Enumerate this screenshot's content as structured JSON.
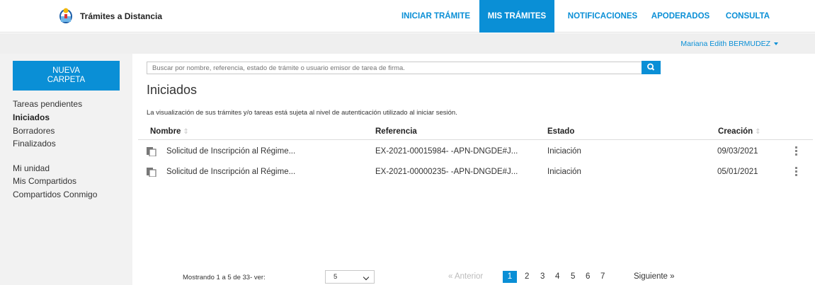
{
  "header": {
    "brand": "Trámites a Distancia",
    "nav": [
      {
        "label": "INICIAR TRÁMITE",
        "active": false
      },
      {
        "label": "MIS TRÁMITES",
        "active": true
      },
      {
        "label": "NOTIFICACIONES",
        "active": false
      },
      {
        "label": "APODERADOS",
        "active": false
      },
      {
        "label": "CONSULTA",
        "active": false
      }
    ],
    "accent_color": "#0a8fd6"
  },
  "user": {
    "name": "Mariana Edith BERMUDEZ"
  },
  "sidebar": {
    "new_folder_line1": "NUEVA",
    "new_folder_line2": "CARPETA",
    "links": [
      {
        "label": "Tareas pendientes"
      },
      {
        "label": "Iniciados",
        "active": true
      },
      {
        "label": "Borradores"
      },
      {
        "label": "Finalizados"
      },
      {
        "label": "Mi unidad"
      },
      {
        "label": "Mis Compartidos"
      },
      {
        "label": "Compartidos Conmigo"
      }
    ]
  },
  "search": {
    "placeholder": "Buscar por nombre, referencia, estado de trámite o usuario emisor de tarea de firma.",
    "icon": "search-icon"
  },
  "main": {
    "title": "Iniciados",
    "notice": "La visualización de sus trámites y/o tareas está sujeta al nivel de autenticación utilizado al iniciar sesión."
  },
  "table": {
    "headers": {
      "nombre": "Nombre",
      "referencia": "Referencia",
      "estado": "Estado",
      "creacion": "Creación"
    },
    "rows": [
      {
        "nombre": "Solicitud de Inscripción al Régime...",
        "referencia": "EX-2021-00015984- -APN-DNGDE#J...",
        "estado": "Iniciación",
        "creacion": "09/03/2021"
      },
      {
        "nombre": "Solicitud de Inscripción al Régime...",
        "referencia": "EX-2021-00000235- -APN-DNGDE#J...",
        "estado": "Iniciación",
        "creacion": "05/01/2021"
      }
    ]
  },
  "footer": {
    "showing": "Mostrando 1 a 5 de 33- ver:",
    "page_size": "5",
    "prev": "« Anterior",
    "pages": [
      "1",
      "2",
      "3",
      "4",
      "5",
      "6",
      "7"
    ],
    "current_page": "1",
    "next": "Siguiente »"
  }
}
